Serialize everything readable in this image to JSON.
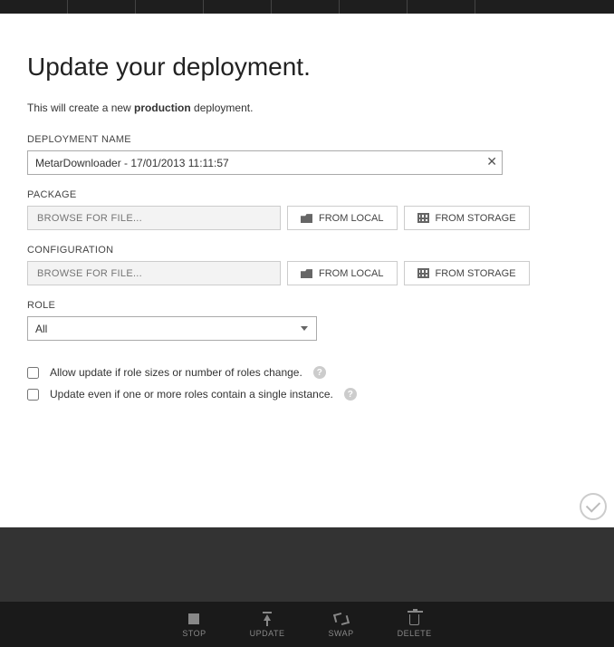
{
  "dialog": {
    "title": "Update your deployment.",
    "subtext_prefix": "This will create a new ",
    "subtext_bold": "production",
    "subtext_suffix": " deployment."
  },
  "fields": {
    "deployment_name_label": "DEPLOYMENT NAME",
    "deployment_name_value": "MetarDownloader - 17/01/2013 11:11:57",
    "package_label": "PACKAGE",
    "configuration_label": "CONFIGURATION",
    "browse_placeholder": "BROWSE FOR FILE...",
    "from_local": "FROM LOCAL",
    "from_storage": "FROM STORAGE",
    "role_label": "ROLE",
    "role_value": "All"
  },
  "checkboxes": {
    "allow_update": "Allow update if role sizes or number of roles change.",
    "update_single": "Update even if one or more roles contain a single instance."
  },
  "bottom": {
    "stop": "STOP",
    "update": "UPDATE",
    "swap": "SWAP",
    "delete": "DELETE"
  }
}
